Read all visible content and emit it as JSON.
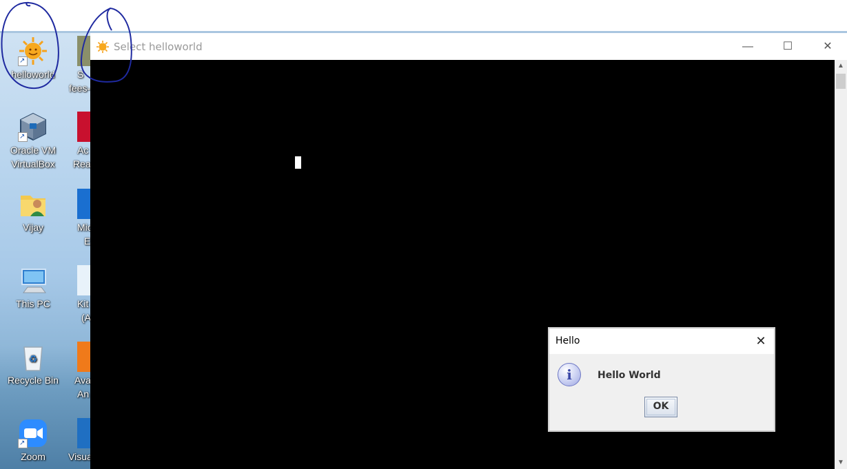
{
  "desktop": {
    "icons": [
      {
        "label_line1": "helloworld",
        "label_line2": "",
        "icon": "sun-icon"
      },
      {
        "label_line1": "Oracle VM",
        "label_line2": "VirtualBox",
        "icon": "virtualbox-icon"
      },
      {
        "label_line1": "Vijay",
        "label_line2": "",
        "icon": "user-folder-icon"
      },
      {
        "label_line1": "This PC",
        "label_line2": "",
        "icon": "computer-icon"
      },
      {
        "label_line1": "Recycle Bin",
        "label_line2": "",
        "icon": "recycle-bin-icon"
      },
      {
        "label_line1": "Zoom",
        "label_line2": "",
        "icon": "zoom-icon"
      }
    ],
    "clipped_labels": [
      {
        "line1": "S",
        "line2": "fees-"
      },
      {
        "line1": "Ac",
        "line2": "Rea"
      },
      {
        "line1": "Mic",
        "line2": "E"
      },
      {
        "line1": "Kit",
        "line2": "(A"
      },
      {
        "line1": "Ava",
        "line2": "An"
      },
      {
        "line1": "Visua",
        "line2": ""
      }
    ]
  },
  "window": {
    "title": "Select helloworld",
    "app_icon": "sun-icon",
    "minimize_symbol": "—",
    "maximize_symbol": "☐",
    "close_symbol": "✕",
    "scroll_up": "▲",
    "scroll_down": "▼"
  },
  "dialog": {
    "title": "Hello",
    "close_symbol": "✕",
    "icon": "info-icon",
    "icon_glyph": "i",
    "message": "Hello World",
    "ok_label": "OK"
  },
  "colors": {
    "console_bg": "#000000",
    "annotation": "#1f2aa0"
  }
}
